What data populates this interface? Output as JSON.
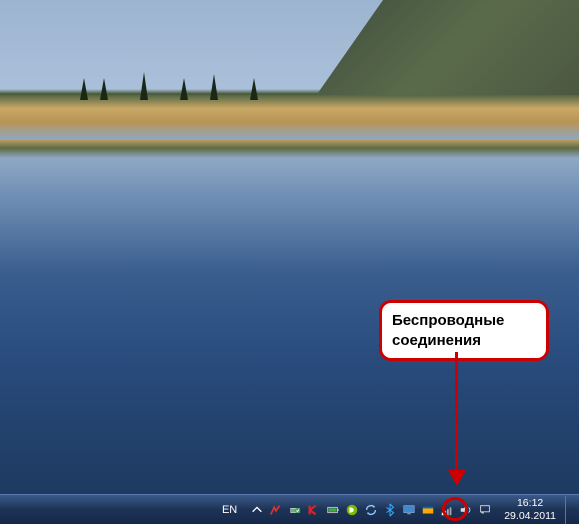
{
  "callout": {
    "line1": "Беспроводные",
    "line2": "соединения"
  },
  "taskbar": {
    "language": "EN",
    "clock": {
      "time": "16:12",
      "date": "29.04.2011"
    },
    "icons": [
      {
        "name": "show-hidden-icon"
      },
      {
        "name": "pppoe-icon"
      },
      {
        "name": "safely-remove-icon"
      },
      {
        "name": "kaspersky-icon"
      },
      {
        "name": "battery-icon"
      },
      {
        "name": "nvidia-icon"
      },
      {
        "name": "sync-icon"
      },
      {
        "name": "bluetooth-icon"
      },
      {
        "name": "monitor-icon"
      },
      {
        "name": "app-icon"
      },
      {
        "name": "network-wireless-icon"
      },
      {
        "name": "volume-icon"
      },
      {
        "name": "action-center-icon"
      }
    ]
  }
}
